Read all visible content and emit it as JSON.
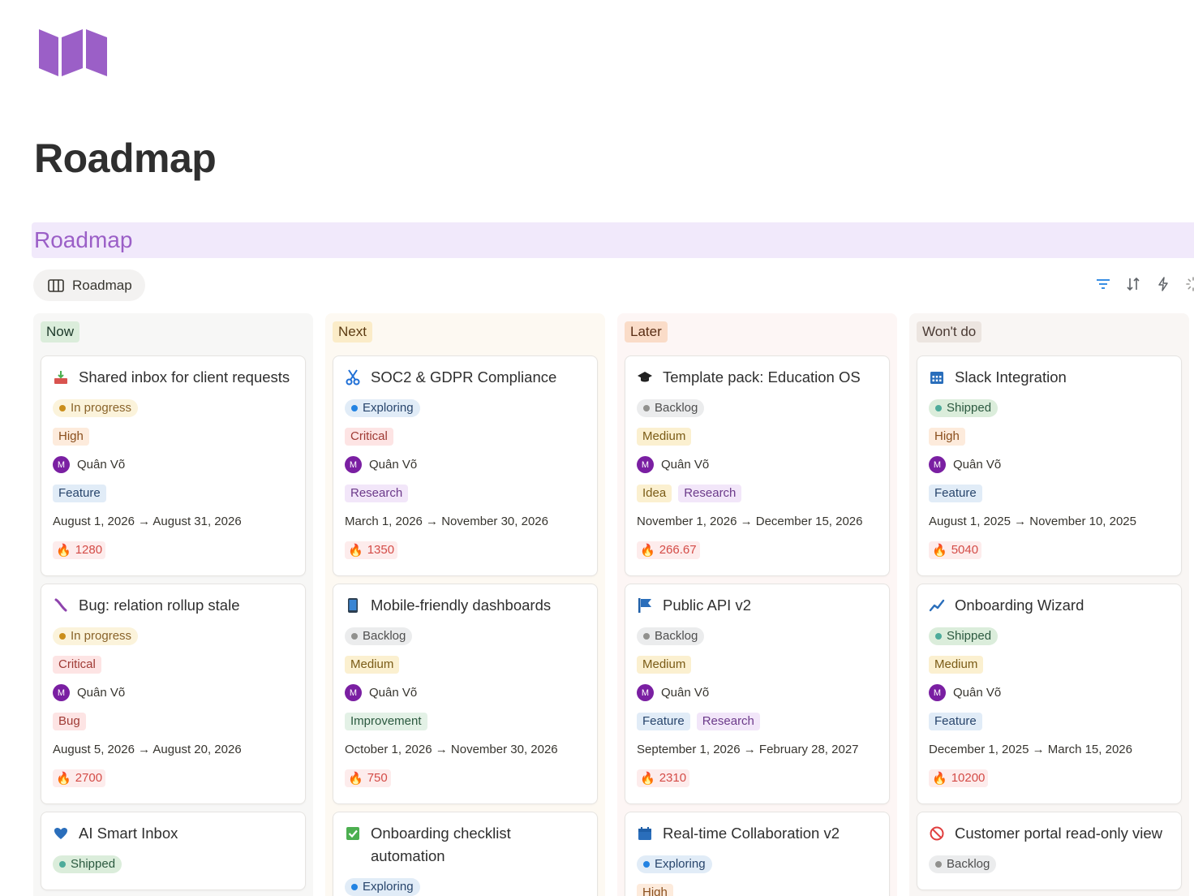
{
  "page": {
    "title": "Roadmap"
  },
  "database": {
    "title": "Roadmap"
  },
  "view": {
    "label": "Roadmap"
  },
  "toolbar": [
    "filter-icon",
    "sort-icon",
    "automation-icon",
    "loading-icon"
  ],
  "colors": {
    "accent": "#9b5fc7",
    "header_bg": "#f1e9fb",
    "score_text": "#d44c47",
    "score_bg": "#fdecec"
  },
  "columns": [
    {
      "label": "Now",
      "cards": [
        {
          "icon": "inbox-tray-icon",
          "title": "Shared inbox for client requests",
          "status": "In progress",
          "priority": "High",
          "assignee": "Quân Võ",
          "avatar": "M",
          "tags": [
            "Feature"
          ],
          "dates": "August 1, 2026 → August 31, 2026",
          "score": "1280"
        },
        {
          "icon": "bug-icon",
          "title": "Bug: relation rollup stale",
          "status": "In progress",
          "priority": "Critical",
          "assignee": "Quân Võ",
          "avatar": "M",
          "tags": [
            "Bug"
          ],
          "dates": "August 5, 2026 → August 20, 2026",
          "score": "2700"
        },
        {
          "icon": "heart-icon",
          "title": "AI Smart Inbox",
          "status": "Shipped",
          "priority": "",
          "assignee": "",
          "avatar": "",
          "tags": [],
          "dates": "",
          "score": ""
        }
      ]
    },
    {
      "label": "Next",
      "cards": [
        {
          "icon": "scissors-icon",
          "title": "SOC2 & GDPR Compliance",
          "status": "Exploring",
          "priority": "Critical",
          "assignee": "Quân Võ",
          "avatar": "M",
          "tags": [
            "Research"
          ],
          "dates": "March 1, 2026 → November 30, 2026",
          "score": "1350"
        },
        {
          "icon": "mobile-phone-icon",
          "title": "Mobile-friendly dashboards",
          "status": "Backlog",
          "priority": "Medium",
          "assignee": "Quân Võ",
          "avatar": "M",
          "tags": [
            "Improvement"
          ],
          "dates": "October 1, 2026 → November 30, 2026",
          "score": "750"
        },
        {
          "icon": "checkbox-icon",
          "title": "Onboarding checklist automation",
          "status": "Exploring",
          "priority": "",
          "assignee": "",
          "avatar": "",
          "tags": [],
          "dates": "",
          "score": ""
        }
      ]
    },
    {
      "label": "Later",
      "cards": [
        {
          "icon": "graduation-cap-icon",
          "title": "Template pack: Education OS",
          "status": "Backlog",
          "priority": "Medium",
          "assignee": "Quân Võ",
          "avatar": "M",
          "tags": [
            "Idea",
            "Research"
          ],
          "dates": "November 1, 2026 → December 15, 2026",
          "score": "266.67"
        },
        {
          "icon": "flag-icon",
          "title": "Public API v2",
          "status": "Backlog",
          "priority": "Medium",
          "assignee": "Quân Võ",
          "avatar": "M",
          "tags": [
            "Feature",
            "Research"
          ],
          "dates": "September 1, 2026 → February 28, 2027",
          "score": "2310"
        },
        {
          "icon": "calendar-icon",
          "title": "Real-time Collaboration v2",
          "status": "Exploring",
          "priority": "High",
          "assignee": "",
          "avatar": "",
          "tags": [],
          "dates": "",
          "score": ""
        }
      ]
    },
    {
      "label": "Won't do",
      "cards": [
        {
          "icon": "calendar-grid-icon",
          "title": "Slack Integration",
          "status": "Shipped",
          "priority": "High",
          "assignee": "Quân Võ",
          "avatar": "M",
          "tags": [
            "Feature"
          ],
          "dates": "August 1, 2025 → November 10, 2025",
          "score": "5040"
        },
        {
          "icon": "trend-up-icon",
          "title": "Onboarding Wizard",
          "status": "Shipped",
          "priority": "Medium",
          "assignee": "Quân Võ",
          "avatar": "M",
          "tags": [
            "Feature"
          ],
          "dates": "December 1, 2025 → March 15, 2026",
          "score": "10200"
        },
        {
          "icon": "prohibited-icon",
          "title": "Customer portal read-only view",
          "status": "Backlog",
          "priority": "",
          "assignee": "",
          "avatar": "",
          "tags": [],
          "dates": "",
          "score": ""
        }
      ]
    }
  ]
}
